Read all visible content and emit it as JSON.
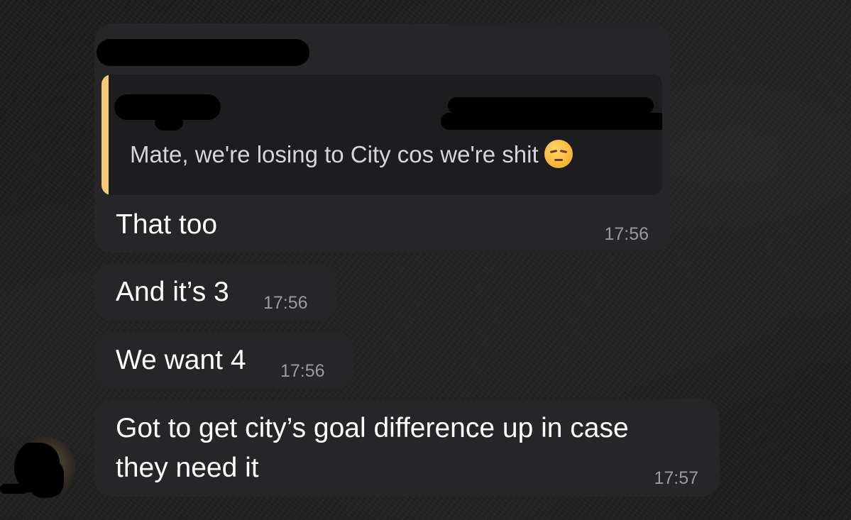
{
  "messages": [
    {
      "quote": {
        "text": "Mate, we're losing to City cos we're shit",
        "emoji": "pensive-face"
      },
      "text": "That too",
      "time": "17:56"
    },
    {
      "text": "And it’s 3",
      "time": "17:56"
    },
    {
      "text": "We want 4",
      "time": "17:56"
    },
    {
      "text_lines": [
        "Got to get city’s goal difference up in case",
        "they need it"
      ],
      "time": "17:57"
    }
  ],
  "colors": {
    "bubble": "#262628",
    "quote_bar": "#f5c97a",
    "timestamp": "#9a9a9e"
  }
}
